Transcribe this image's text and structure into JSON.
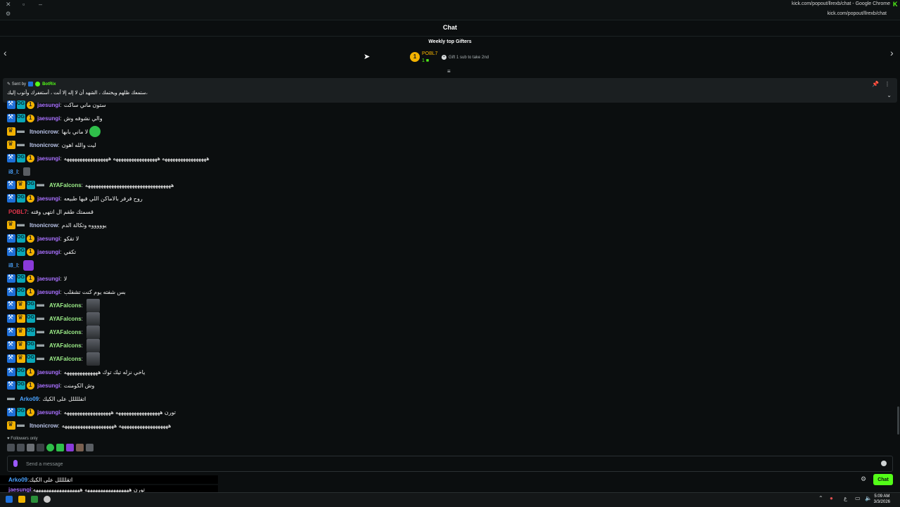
{
  "browser": {
    "window_title": "kick.com/popout/llrexb/chat - Google Chrome",
    "url": "kick.com/popout/llrexb/chat"
  },
  "chat": {
    "title": "Chat",
    "weekly_top_gifters": "Weekly top Gifters",
    "top_gifter": {
      "rank": "1",
      "name": "POBL7",
      "count": "1"
    },
    "gift_hint": "Gift 1 sub to take 2nd"
  },
  "pinned": {
    "sent_by_label": "Sent by",
    "sender": "BotRix",
    "text": "،ستمعك ظلهم ويختمك ، الشهد أن لا إله إلا أنت ، أستغفرك وأتوب إليك"
  },
  "messages": [
    {
      "user": "jaesungi",
      "user_color": "#a970ff",
      "badges": [
        "mod",
        "og",
        "gift"
      ],
      "text": "ستون ماني ساكت"
    },
    {
      "user": "jaesungi",
      "user_color": "#a970ff",
      "badges": [
        "mod",
        "og",
        "gift"
      ],
      "text": "والي نشوفه وش"
    },
    {
      "user": "Itnonicrow",
      "user_color": "#b9c3e8",
      "badges": [
        "crown",
        "gun"
      ],
      "text": "لا ماني بابها",
      "emote": "green"
    },
    {
      "user": "Itnonicrow",
      "user_color": "#b9c3e8",
      "badges": [
        "crown",
        "gun"
      ],
      "text": "ليت والله اهون"
    },
    {
      "user": "jaesungi",
      "user_color": "#a970ff",
      "badges": [
        "mod",
        "og",
        "gift"
      ],
      "text": "هههههههههههههههههه هههههههههههههههههه هههههههههههههههههه"
    },
    {
      "user": "i8_l",
      "user_color": "#4aa3ff",
      "badges": [],
      "text": "",
      "emote": "gray"
    },
    {
      "user": "AYAFalcons",
      "user_color": "#9ef08a",
      "badges": [
        "mod",
        "crown",
        "og",
        "gun"
      ],
      "text": "هههههههههههههههههههههههههههههههههه"
    },
    {
      "user": "jaesungi",
      "user_color": "#a970ff",
      "badges": [
        "mod",
        "og",
        "gift"
      ],
      "text": "روح فرفر بالاماكن اللي فيها طبيعه"
    },
    {
      "user": "POBL7",
      "user_color": "#e0344a",
      "badges": [],
      "text": "قسمتك طقم ال انتهى وقته"
    },
    {
      "user": "Itnonicrow",
      "user_color": "#b9c3e8",
      "badges": [
        "crown",
        "gun"
      ],
      "text": "يوووووه وتكالة الدم"
    },
    {
      "user": "jaesungi",
      "user_color": "#a970ff",
      "badges": [
        "mod",
        "og",
        "gift"
      ],
      "text": "لا تقكو"
    },
    {
      "user": "jaesungi",
      "user_color": "#a970ff",
      "badges": [
        "mod",
        "og",
        "gift"
      ],
      "text": "تكفي"
    },
    {
      "user": "i8_l",
      "user_color": "#4aa3ff",
      "badges": [],
      "text": "",
      "emote": "purple"
    },
    {
      "user": "jaesungi",
      "user_color": "#a970ff",
      "badges": [
        "mod",
        "og",
        "gift"
      ],
      "text": "لا"
    },
    {
      "user": "jaesungi",
      "user_color": "#a970ff",
      "badges": [
        "mod",
        "og",
        "gift"
      ],
      "text": "بس شفته يوم كنت تشقلب"
    },
    {
      "user": "AYAFalcons",
      "user_color": "#9ef08a",
      "badges": [
        "mod",
        "crown",
        "og",
        "gun"
      ],
      "text": "",
      "emote": "big"
    },
    {
      "user": "AYAFalcons",
      "user_color": "#9ef08a",
      "badges": [
        "mod",
        "crown",
        "og",
        "gun"
      ],
      "text": "",
      "emote": "big"
    },
    {
      "user": "AYAFalcons",
      "user_color": "#9ef08a",
      "badges": [
        "mod",
        "crown",
        "og",
        "gun"
      ],
      "text": "",
      "emote": "big"
    },
    {
      "user": "AYAFalcons",
      "user_color": "#9ef08a",
      "badges": [
        "mod",
        "crown",
        "og",
        "gun"
      ],
      "text": "",
      "emote": "big"
    },
    {
      "user": "AYAFalcons",
      "user_color": "#9ef08a",
      "badges": [
        "mod",
        "crown",
        "og",
        "gun"
      ],
      "text": "",
      "emote": "big"
    },
    {
      "user": "jaesungi",
      "user_color": "#a970ff",
      "badges": [
        "mod",
        "og",
        "gift"
      ],
      "text": "ياخي نزله تيك توك هههههههههههههه"
    },
    {
      "user": "jaesungi",
      "user_color": "#a970ff",
      "badges": [
        "mod",
        "og",
        "gift"
      ],
      "text": "وش الكومنت"
    },
    {
      "user": "Arko09",
      "user_color": "#4aa3ff",
      "badges": [
        "gun"
      ],
      "text": "اتقللللل على الكيك"
    },
    {
      "user": "jaesungi",
      "user_color": "#a970ff",
      "badges": [
        "mod",
        "og",
        "gift"
      ],
      "text": "تورن هههههههههههههههههه ههههههههههههههههههه"
    },
    {
      "user": "Itnonicrow",
      "user_color": "#b9c3e8",
      "badges": [
        "crown",
        "gun"
      ],
      "text": "هههههههههههههههههههه ههههههههههههههههههههه"
    }
  ],
  "footer": {
    "followers_only": "Followers only",
    "input_placeholder": "Send a message",
    "chat_button": "Chat"
  },
  "overlay": [
    {
      "user": "Arko09",
      "user_color": "#4aa3ff",
      "text": "اتقللللل على الكيك"
    },
    {
      "user": "jaesungi",
      "user_color": "#a970ff",
      "text": "تورن هههههههههههههههههه ههههههههههههههههههه"
    },
    {
      "user": "Itnonicrow",
      "user_color": "#b9c3e8",
      "text": "هههههههههههههههههههه ههههههههههههههههههههه"
    }
  ],
  "taskbar": {
    "time": "5:09 AM",
    "date": "3/3/2026"
  }
}
